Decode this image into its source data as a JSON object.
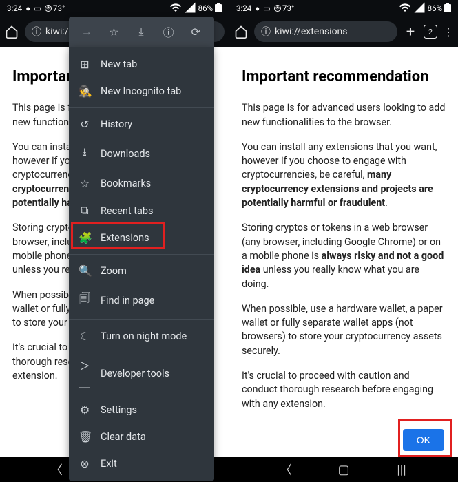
{
  "status": {
    "time": "3:24",
    "temp": "73°",
    "battery": "86%"
  },
  "left": {
    "url": "kiwi:/",
    "heading": "Important",
    "p1": "This page is fo",
    "p1b": "new functionali",
    "p2a": "You can install",
    "p2b": "however if you",
    "p2c": "cryptocurrenci",
    "p2bold1": "cryptocurrency",
    "p2bold2": "potentially harm",
    "p3a": "Storing cryptos",
    "p3b": "browser, includ",
    "p3c": "mobile phone i",
    "p3d": "unless you rea",
    "p4a": "When possible",
    "p4b": "wallet or fully s",
    "p4c": "to store your c",
    "p5a": "It's crucial to p",
    "p5b": "thorough resea",
    "p5c": "extension."
  },
  "menu": {
    "new_tab": "New tab",
    "incognito": "New Incognito tab",
    "history": "History",
    "downloads": "Downloads",
    "bookmarks": "Bookmarks",
    "recent": "Recent tabs",
    "extensions": "Extensions",
    "zoom": "Zoom",
    "find": "Find in page",
    "night": "Turn on night mode",
    "devtools": "Developer tools",
    "settings": "Settings",
    "clear": "Clear data",
    "exit": "Exit"
  },
  "right": {
    "url": "kiwi://extensions",
    "tabs": "2",
    "heading": "Important recommendation",
    "p1": "This page is for advanced users looking to add new functionalities to the browser.",
    "p2a": "You can install any extensions that you want, however if you choose to engage with cryptocurrencies, be careful, ",
    "p2b": "many cryptocurrency extensions and projects are potentially harmful or fraudulent",
    "p2c": ".",
    "p3a": "Storing cryptos or tokens in a web browser (any browser, including Google Chrome) or on a mobile phone is ",
    "p3b": "always risky and not a good idea",
    "p3c": " unless you really know what you are doing.",
    "p4": "When possible, use a hardware wallet, a paper wallet or fully separate wallet apps (not browsers) to store your cryptocurrency assets securely.",
    "p5": "It's crucial to proceed with caution and conduct thorough research before engaging with any extension.",
    "ok": "OK"
  }
}
